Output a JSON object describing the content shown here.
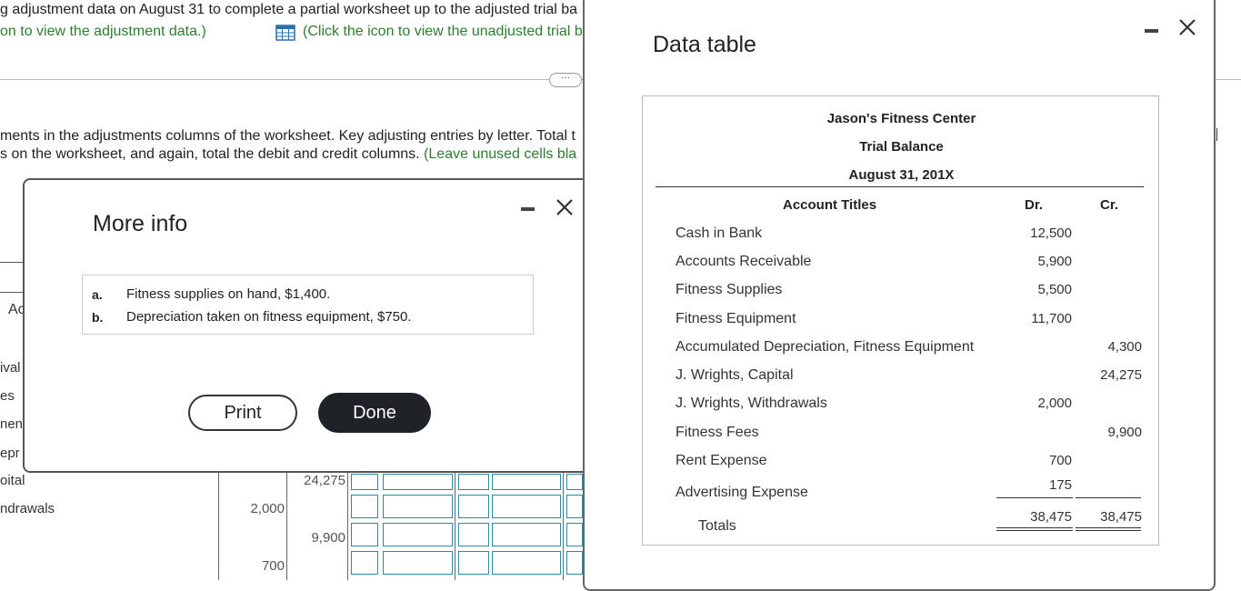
{
  "background": {
    "line1": "g adjustment data on August 31 to complete a partial worksheet up to the adjusted trial ba",
    "line2_left": "on to view the adjustment data.)",
    "line2_right": "(Click the icon to view the unadjusted trial b",
    "instr1": "ments in the adjustments columns of the worksheet. Key adjusting entries by letter. Total t",
    "instr2a": "s on the worksheet, and again, total the debit and credit columns.",
    "instr2b": "(Leave unused cells bla",
    "ellipsis": "···",
    "col_header_partial": "Ac",
    "row_labels": [
      "ival",
      "es",
      "nent",
      "epr",
      "oital",
      "ndrawals"
    ],
    "values": [
      "24,275",
      "2,000",
      "9,900",
      "700"
    ]
  },
  "more_info": {
    "title": "More info",
    "items": [
      {
        "letter": "a.",
        "text": "Fitness supplies on hand, $1,400."
      },
      {
        "letter": "b.",
        "text": "Depreciation taken on fitness equipment, $750."
      }
    ],
    "print_label": "Print",
    "done_label": "Done"
  },
  "data_table": {
    "title": "Data table",
    "company": "Jason's Fitness Center",
    "report": "Trial Balance",
    "date": "August 31, 201X",
    "col_account": "Account Titles",
    "col_dr": "Dr.",
    "col_cr": "Cr.",
    "rows": [
      {
        "account": "Cash in Bank",
        "dr": "12,500",
        "cr": ""
      },
      {
        "account": "Accounts Receivable",
        "dr": "5,900",
        "cr": ""
      },
      {
        "account": "Fitness Supplies",
        "dr": "5,500",
        "cr": ""
      },
      {
        "account": "Fitness Equipment",
        "dr": "11,700",
        "cr": ""
      },
      {
        "account": "Accumulated Depreciation, Fitness Equipment",
        "dr": "",
        "cr": "4,300"
      },
      {
        "account": "J. Wrights, Capital",
        "dr": "",
        "cr": "24,275"
      },
      {
        "account": "J. Wrights, Withdrawals",
        "dr": "2,000",
        "cr": ""
      },
      {
        "account": "Fitness Fees",
        "dr": "",
        "cr": "9,900"
      },
      {
        "account": "Rent Expense",
        "dr": "700",
        "cr": ""
      },
      {
        "account": "Advertising Expense",
        "dr": "175",
        "cr": ""
      }
    ],
    "totals_label": "Totals",
    "total_dr": "38,475",
    "total_cr": "38,475"
  },
  "colors": {
    "accent_green": "#2e7d32",
    "cell_border": "#2a8ba5",
    "done_button": "#1f2328"
  }
}
